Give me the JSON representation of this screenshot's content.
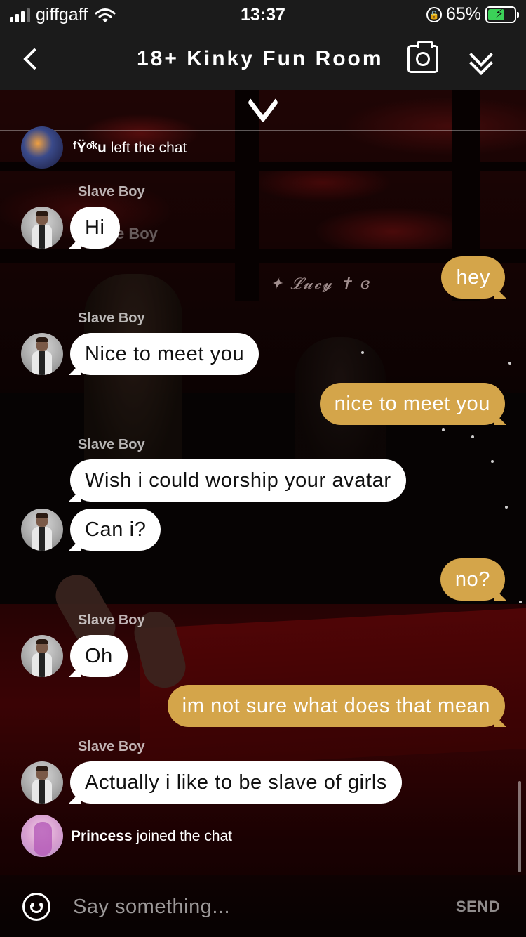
{
  "status_bar": {
    "carrier": "giffgaff",
    "time": "13:37",
    "battery": "65%",
    "battery_level": 0.65,
    "icons": [
      "signal-icon",
      "wifi-icon",
      "orientation-lock-icon",
      "battery-charging-icon"
    ]
  },
  "nav": {
    "title": "18+ Kinky Fun Room",
    "icons": [
      "back-chevron-icon",
      "camera-icon",
      "double-chevron-down-icon"
    ]
  },
  "chat": {
    "left_event": {
      "name": "ᶠŸᵒ̊ᵏu",
      "text": "left the chat"
    },
    "joined_event": {
      "name": "Princess",
      "text": "joined the chat"
    },
    "background_labels": {
      "lucy": "✦ 𝓛𝓾𝓬𝔂 ✝ ɞ",
      "boy_overlay": "e Boy"
    },
    "messages": [
      {
        "sender": "Slave Boy",
        "text": "Hi",
        "direction": "in"
      },
      {
        "sender": "",
        "text": "hey",
        "direction": "out"
      },
      {
        "sender": "Slave Boy",
        "text": "Nice to meet you",
        "direction": "in"
      },
      {
        "sender": "",
        "text": "nice to meet you",
        "direction": "out"
      },
      {
        "sender": "Slave Boy",
        "text": "Wish i could worship your avatar",
        "direction": "in"
      },
      {
        "sender": "",
        "text": "Can i?",
        "direction": "in"
      },
      {
        "sender": "",
        "text": "no?",
        "direction": "out"
      },
      {
        "sender": "Slave Boy",
        "text": "Oh",
        "direction": "in"
      },
      {
        "sender": "",
        "text": "im not sure what does that mean",
        "direction": "out"
      },
      {
        "sender": "Slave Boy",
        "text": "Actually i like to be slave of girls",
        "direction": "in"
      }
    ]
  },
  "composer": {
    "placeholder": "Say something...",
    "send_label": "SEND"
  },
  "colors": {
    "incoming_bubble": "#ffffff",
    "outgoing_bubble": "#d4a54a",
    "bar_background": "#1b1b1b",
    "battery_fill": "#3bd158"
  }
}
